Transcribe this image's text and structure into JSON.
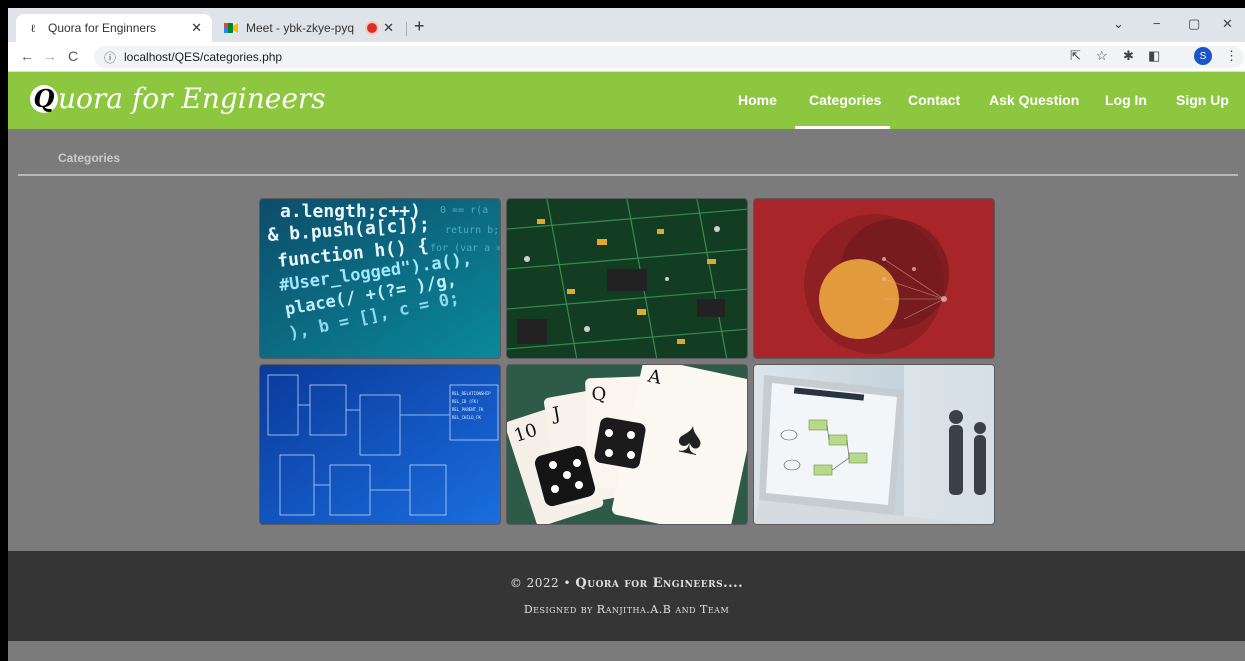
{
  "browser": {
    "tabs": [
      {
        "title": "Quora for Enginners",
        "favicon": "quora-favicon",
        "active": true
      },
      {
        "title": "Meet - ybk-zkye-pyq",
        "favicon": "meet-favicon",
        "active": false,
        "recording": true
      }
    ],
    "new_tab_label": "+",
    "window_controls": {
      "dropdown": "⌄",
      "minimize": "−",
      "restore": "▢",
      "close": "✕"
    },
    "back": "←",
    "forward": "→",
    "reload": "C",
    "url": "localhost/QES/categories.php",
    "profile_initial": "S"
  },
  "site": {
    "logo_letter": "Q",
    "logo_text": "uora for Engineers",
    "nav": {
      "home": "Home",
      "categories": "Categories",
      "contact": "Contact",
      "ask": "Ask Question",
      "login": "Log In",
      "signup": "Sign Up"
    },
    "active_nav": "Categories"
  },
  "breadcrumb": "Categories",
  "categories": [
    {
      "image": "code-closeup"
    },
    {
      "image": "circuit-board"
    },
    {
      "image": "red-diagram"
    },
    {
      "image": "database-schema"
    },
    {
      "image": "cards-and-dice"
    },
    {
      "image": "laptop-flowchart"
    }
  ],
  "footer": {
    "line1_prefix": "© 2022 •",
    "line1_name": "Quora for Engineers....",
    "line2": "Designed by Ranjitha.A.B and Team"
  },
  "colors": {
    "header_green": "#8dc63f",
    "page_bg": "#7b7b7b",
    "footer_bg": "#353535"
  }
}
